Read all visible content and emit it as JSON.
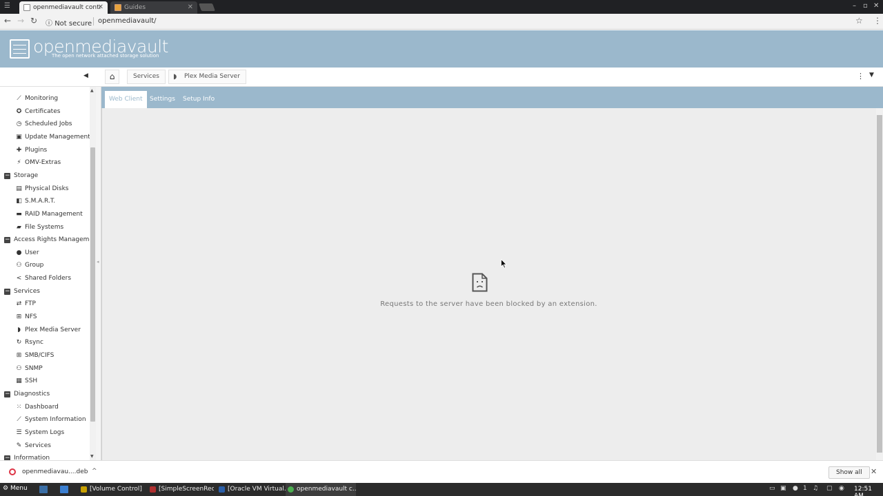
{
  "browser": {
    "tabs": [
      {
        "title": "openmediavault contr",
        "active": true
      },
      {
        "title": "Guides",
        "active": false
      }
    ],
    "security": "Not secure",
    "url": "openmediavault/"
  },
  "app": {
    "logo_title": "openmediavault",
    "logo_subtitle": "The open network attached storage solution"
  },
  "breadcrumb": {
    "items": [
      "Services",
      "Plex Media Server"
    ]
  },
  "sidebar": {
    "items": [
      {
        "label": "Monitoring",
        "icon": "chart-line-icon",
        "group": false
      },
      {
        "label": "Certificates",
        "icon": "certificate-icon",
        "group": false
      },
      {
        "label": "Scheduled Jobs",
        "icon": "clock-icon",
        "group": false
      },
      {
        "label": "Update Management",
        "icon": "update-icon",
        "group": false
      },
      {
        "label": "Plugins",
        "icon": "puzzle-icon",
        "group": false
      },
      {
        "label": "OMV-Extras",
        "icon": "plug-icon",
        "group": false
      },
      {
        "label": "Storage",
        "icon": "minus-square-icon",
        "group": true
      },
      {
        "label": "Physical Disks",
        "icon": "disk-icon",
        "group": false
      },
      {
        "label": "S.M.A.R.T.",
        "icon": "smart-icon",
        "group": false
      },
      {
        "label": "RAID Management",
        "icon": "raid-icon",
        "group": false
      },
      {
        "label": "File Systems",
        "icon": "folder-icon",
        "group": false
      },
      {
        "label": "Access Rights Management",
        "icon": "minus-square-icon",
        "group": true
      },
      {
        "label": "User",
        "icon": "user-icon",
        "group": false
      },
      {
        "label": "Group",
        "icon": "users-icon",
        "group": false
      },
      {
        "label": "Shared Folders",
        "icon": "share-icon",
        "group": false
      },
      {
        "label": "Services",
        "icon": "minus-square-icon",
        "group": true
      },
      {
        "label": "FTP",
        "icon": "ftp-icon",
        "group": false
      },
      {
        "label": "NFS",
        "icon": "nfs-icon",
        "group": false
      },
      {
        "label": "Plex Media Server",
        "icon": "plex-icon",
        "group": false
      },
      {
        "label": "Rsync",
        "icon": "rsync-icon",
        "group": false
      },
      {
        "label": "SMB/CIFS",
        "icon": "windows-icon",
        "group": false
      },
      {
        "label": "SNMP",
        "icon": "snmp-icon",
        "group": false
      },
      {
        "label": "SSH",
        "icon": "terminal-icon",
        "group": false
      },
      {
        "label": "Diagnostics",
        "icon": "minus-square-icon",
        "group": true
      },
      {
        "label": "Dashboard",
        "icon": "grid-icon",
        "group": false
      },
      {
        "label": "System Information",
        "icon": "chart-line-icon",
        "group": false
      },
      {
        "label": "System Logs",
        "icon": "list-icon",
        "group": false
      },
      {
        "label": "Services",
        "icon": "wrench-icon",
        "group": false
      },
      {
        "label": "Information",
        "icon": "minus-square-icon",
        "group": true
      }
    ]
  },
  "main": {
    "tabs": [
      "Web Client",
      "Settings",
      "Setup Info"
    ],
    "active_tab": "Web Client",
    "blocked_message": "Requests to the server have been blocked by an extension."
  },
  "download_bar": {
    "file": "openmediavau....deb",
    "show_all": "Show all"
  },
  "taskbar": {
    "menu": "Menu",
    "windows": [
      "[Volume Control]",
      "[SimpleScreenRec...",
      "[Oracle VM Virtual...",
      "openmediavault c..."
    ],
    "workspace": "1",
    "clock": "12:51 AM"
  },
  "colors": {
    "header": "#9bb8cc",
    "content_bg": "#ededed"
  }
}
